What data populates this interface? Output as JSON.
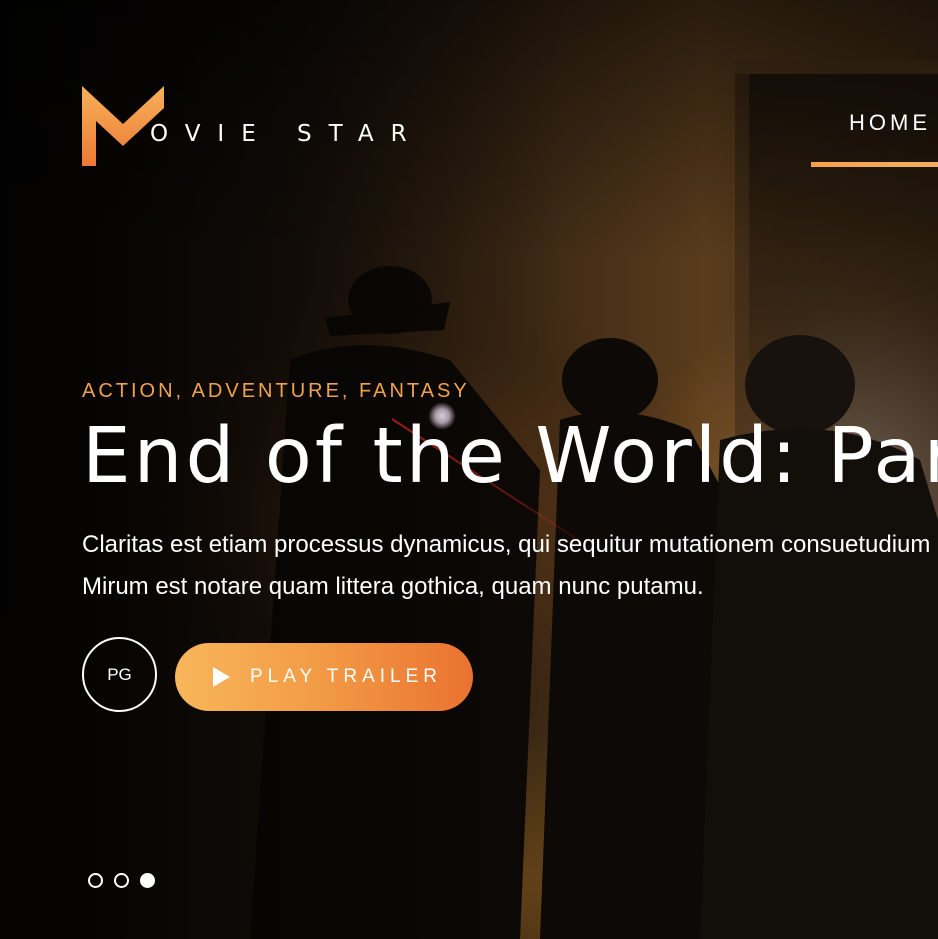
{
  "brand": {
    "logo_text": "OVIE STAR",
    "accent_color": "#f29a45"
  },
  "nav": {
    "items": [
      {
        "label": "HOME",
        "active": true
      }
    ]
  },
  "hero": {
    "genres": "ACTION, ADVENTURE, FANTASY",
    "title": "End of the World: Part I",
    "description": "Claritas est etiam processus dynamicus, qui sequitur mutationem consuetudium lectorum. Mirum est notare quam littera gothica, quam nunc putamu.",
    "rating": "PG",
    "play_label": "PLAY TRAILER",
    "play_icon": "play-icon"
  },
  "slider": {
    "count": 3,
    "active_index": 2
  }
}
